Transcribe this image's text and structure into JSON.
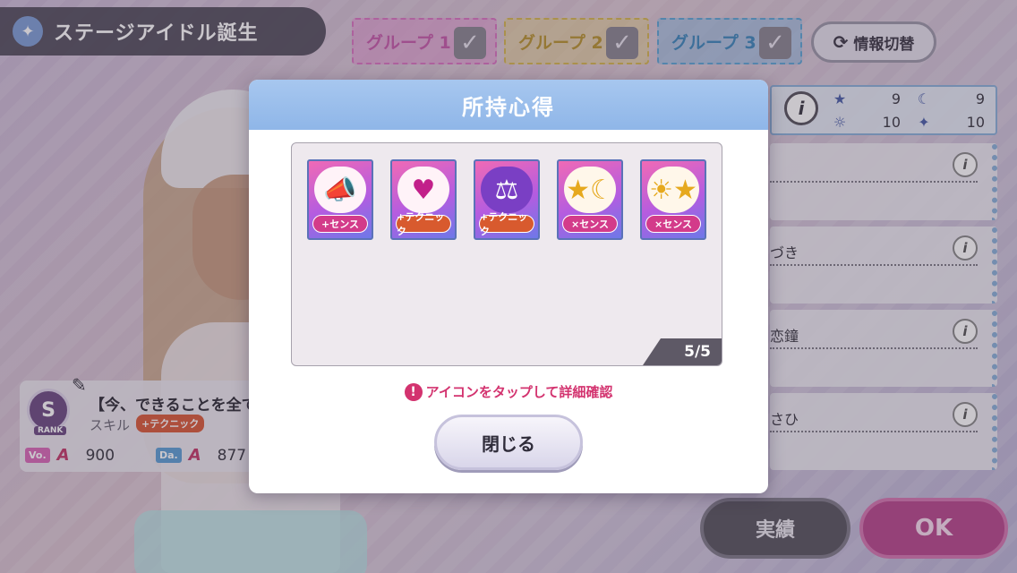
{
  "header": {
    "title": "ステージアイドル誕生",
    "title_icon": "bird-icon"
  },
  "groups": [
    {
      "label": "グループ 1",
      "checked": true,
      "color": "#d874c0"
    },
    {
      "label": "グループ 2",
      "checked": true,
      "color": "#d4b650"
    },
    {
      "label": "グループ 3",
      "checked": true,
      "color": "#5ea6d4"
    }
  ],
  "info_switch": {
    "label": "情報切替"
  },
  "stats": {
    "star": "9",
    "moon": "9",
    "sun": "10",
    "sparkle": "10"
  },
  "side_cards": [
    {
      "text": ""
    },
    {
      "text": "づき"
    },
    {
      "text": "恋鐘"
    },
    {
      "text": "さひ"
    }
  ],
  "buttons": {
    "jisseki": "実績",
    "ok": "OK",
    "close": "閉じる"
  },
  "idol_card": {
    "rank": "S",
    "rank_label": "RANK",
    "title": "【今、できることを全て",
    "skill_label": "スキル",
    "skill_badge": "+テクニック",
    "vo_label": "Vo.",
    "vo_value": "900",
    "da_label": "Da.",
    "da_value": "877"
  },
  "modal": {
    "title": "所持心得",
    "count": "5/5",
    "hint": "アイコンをタップして詳細確認",
    "items": [
      {
        "icon": "megaphone-icon",
        "tag": "+センス",
        "type": "sense"
      },
      {
        "icon": "heart-in-hand-icon",
        "tag": "+テクニック",
        "type": "tech"
      },
      {
        "icon": "dumbbell-icon",
        "tag": "+テクニック",
        "type": "tech"
      },
      {
        "icon": "star-moon-icon",
        "tag": "×センス",
        "type": "sense"
      },
      {
        "icon": "sun-star-icon",
        "tag": "×センス",
        "type": "sense"
      }
    ]
  }
}
